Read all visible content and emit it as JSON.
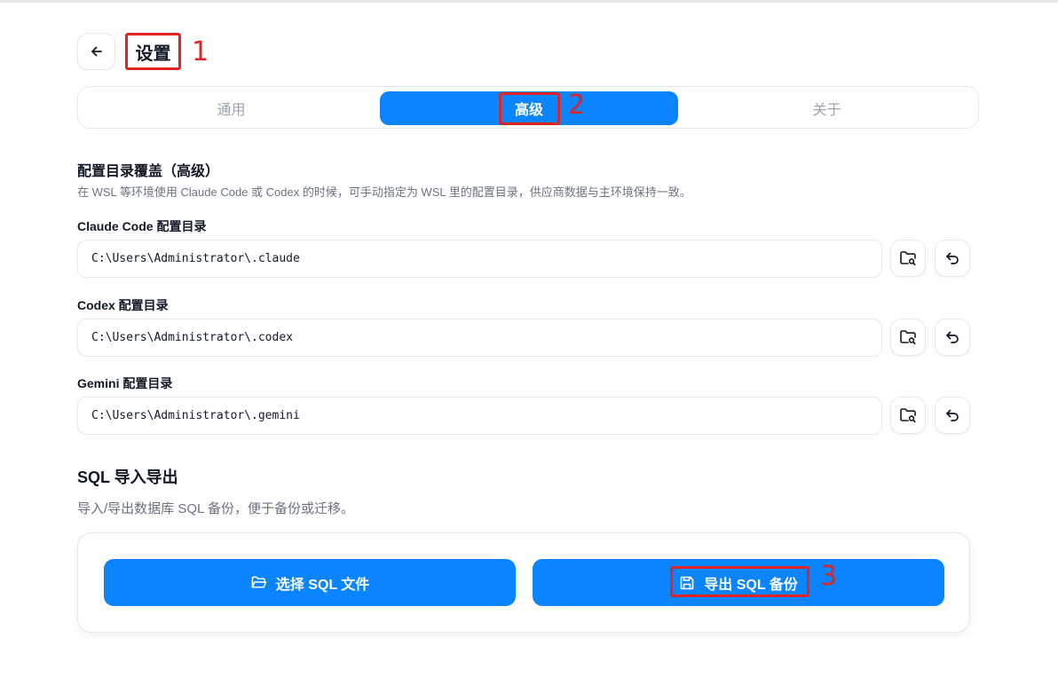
{
  "header": {
    "back_icon": "arrow-left-icon",
    "title": "设置"
  },
  "annotations": [
    "1",
    "2",
    "3"
  ],
  "tabs": [
    {
      "label": "通用",
      "active": false
    },
    {
      "label": "高级",
      "active": true
    },
    {
      "label": "关于",
      "active": false
    }
  ],
  "config_override": {
    "title": "配置目录覆盖（高级）",
    "description": "在 WSL 等环境使用 Claude Code 或 Codex 的时候，可手动指定为 WSL 里的配置目录，供应商数据与主环境保持一致。",
    "fields": [
      {
        "label": "Claude Code 配置目录",
        "value": "C:\\Users\\Administrator\\.claude"
      },
      {
        "label": "Codex 配置目录",
        "value": "C:\\Users\\Administrator\\.codex"
      },
      {
        "label": "Gemini 配置目录",
        "value": "C:\\Users\\Administrator\\.gemini"
      }
    ],
    "browse_icon": "folder-search-icon",
    "reset_icon": "undo-icon"
  },
  "sql": {
    "title": "SQL 导入导出",
    "description": "导入/导出数据库 SQL 备份，便于备份或迁移。",
    "select_label": "选择 SQL 文件",
    "select_icon": "folder-open-icon",
    "export_label": "导出 SQL 备份",
    "export_icon": "save-icon"
  },
  "colors": {
    "accent": "#0a84ff",
    "annotation": "#e02424"
  }
}
